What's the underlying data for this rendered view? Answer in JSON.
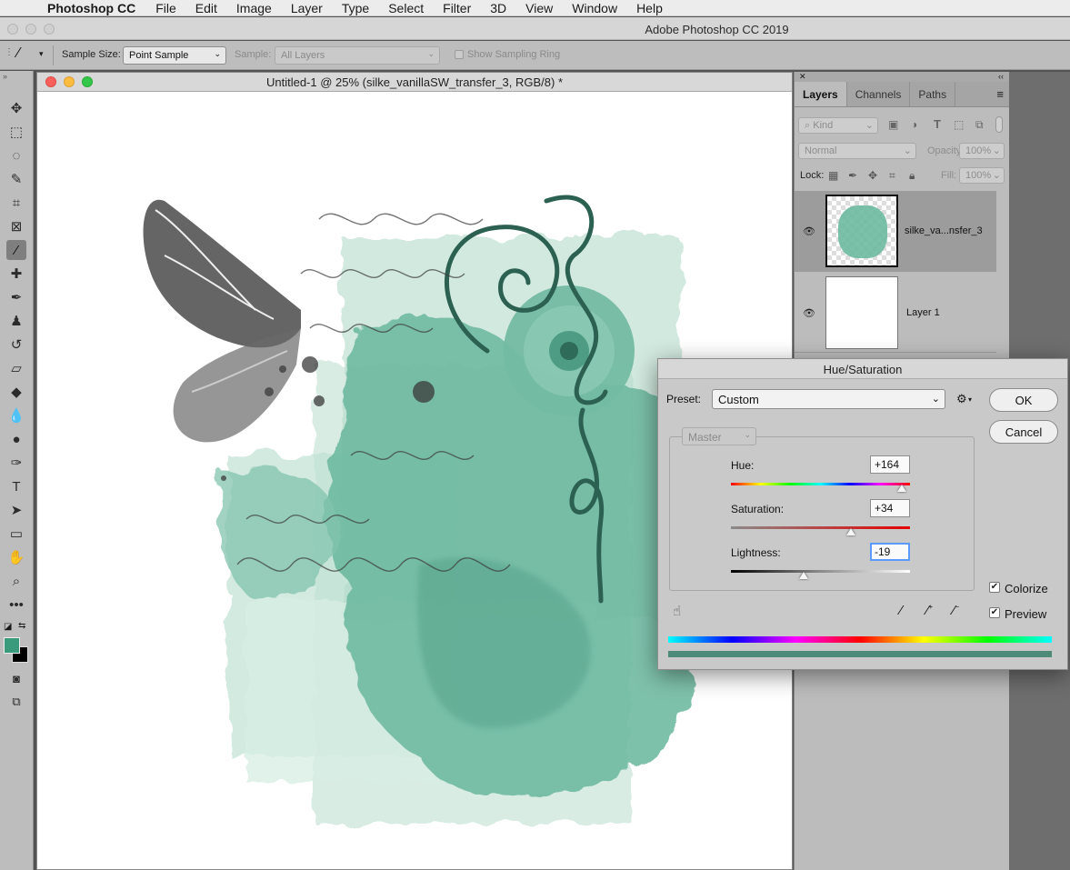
{
  "menubar": {
    "app_name": "Photoshop CC",
    "items": [
      "File",
      "Edit",
      "Image",
      "Layer",
      "Type",
      "Select",
      "Filter",
      "3D",
      "View",
      "Window",
      "Help"
    ]
  },
  "window": {
    "title": "Adobe Photoshop CC 2019"
  },
  "options_bar": {
    "sample_size_label": "Sample Size:",
    "sample_size_value": "Point Sample",
    "sample_label": "Sample:",
    "sample_value": "All Layers",
    "show_sampling_ring_label": "Show Sampling Ring"
  },
  "tools": [
    {
      "icon": "move-icon",
      "glyph": "✥"
    },
    {
      "icon": "marquee-icon",
      "glyph": "⬚"
    },
    {
      "icon": "lasso-icon",
      "glyph": "◌"
    },
    {
      "icon": "quick-select-icon",
      "glyph": "✎"
    },
    {
      "icon": "crop-icon",
      "glyph": "⌗"
    },
    {
      "icon": "frame-icon",
      "glyph": "⊠"
    },
    {
      "icon": "eyedropper-icon",
      "glyph": "⁄"
    },
    {
      "icon": "healing-brush-icon",
      "glyph": "✚"
    },
    {
      "icon": "brush-icon",
      "glyph": "✒"
    },
    {
      "icon": "clone-stamp-icon",
      "glyph": "♟"
    },
    {
      "icon": "history-brush-icon",
      "glyph": "↺"
    },
    {
      "icon": "eraser-icon",
      "glyph": "▱"
    },
    {
      "icon": "paint-bucket-icon",
      "glyph": "◆"
    },
    {
      "icon": "blur-icon",
      "glyph": "💧"
    },
    {
      "icon": "dodge-icon",
      "glyph": "●"
    },
    {
      "icon": "pen-icon",
      "glyph": "✑"
    },
    {
      "icon": "type-icon",
      "glyph": "T"
    },
    {
      "icon": "path-select-icon",
      "glyph": "➤"
    },
    {
      "icon": "rectangle-icon",
      "glyph": "▭"
    },
    {
      "icon": "hand-icon",
      "glyph": "✋"
    },
    {
      "icon": "zoom-icon",
      "glyph": "⌕"
    },
    {
      "icon": "more-tools-icon",
      "glyph": "•••"
    }
  ],
  "colors": {
    "foreground": "#3a9a7c",
    "background": "#000000",
    "teal": "#6cb8a0",
    "dark_teal": "#2c6152"
  },
  "document": {
    "title": "Untitled-1 @ 25% (silke_vanillaSW_transfer_3, RGB/8) *"
  },
  "layers_panel": {
    "tabs": [
      "Layers",
      "Channels",
      "Paths"
    ],
    "kind_label": "Kind",
    "blend_mode": "Normal",
    "opacity_label": "Opacity:",
    "opacity_value": "100%",
    "lock_label": "Lock:",
    "fill_label": "Fill:",
    "fill_value": "100%",
    "layers": [
      {
        "name": "silke_va...nsfer_3",
        "selected": true
      },
      {
        "name": "Layer 1",
        "selected": false
      }
    ]
  },
  "hue_saturation": {
    "title": "Hue/Saturation",
    "preset_label": "Preset:",
    "preset_value": "Custom",
    "channel_value": "Master",
    "hue_label": "Hue:",
    "hue_value": "+164",
    "hue_level": 164,
    "saturation_label": "Saturation:",
    "saturation_value": "+34",
    "saturation_level": 34,
    "lightness_label": "Lightness:",
    "lightness_value": "-19",
    "lightness_level": -19,
    "ok_label": "OK",
    "cancel_label": "Cancel",
    "colorize_label": "Colorize",
    "colorize_checked": true,
    "preview_label": "Preview",
    "preview_checked": true
  }
}
